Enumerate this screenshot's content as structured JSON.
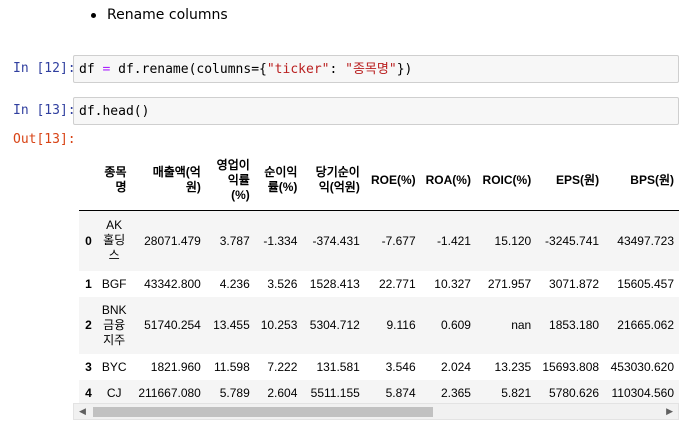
{
  "markdown": {
    "bullet": "Rename columns"
  },
  "cells": [
    {
      "prompt": "In [12]:",
      "code_parts": [
        "df ",
        "=",
        " df.rename(columns={",
        "\"ticker\"",
        ": ",
        "\"종목명\"",
        "})"
      ]
    },
    {
      "prompt": "In [13]:",
      "code": "df.head()"
    }
  ],
  "output_prompt": "Out[13]:",
  "table": {
    "columns": [
      "종목\n명",
      "매출액(억\n원)",
      "영업이\n익률\n(%)",
      "순이익\n률(%)",
      "당기순이\n익(억원)",
      "ROE(%)",
      "ROA(%)",
      "ROIC(%)",
      "EPS(원)",
      "BPS(원)"
    ],
    "rows": [
      {
        "index": "0",
        "cells": [
          "AK\n홀딩\n스",
          "28071.479",
          "3.787",
          "-1.334",
          "-374.431",
          "-7.677",
          "-1.421",
          "15.120",
          "-3245.741",
          "43497.723"
        ]
      },
      {
        "index": "1",
        "cells": [
          "BGF",
          "43342.800",
          "4.236",
          "3.526",
          "1528.413",
          "22.771",
          "10.327",
          "271.957",
          "3071.872",
          "15605.457"
        ]
      },
      {
        "index": "2",
        "cells": [
          "BNK\n금융\n지주",
          "51740.254",
          "13.455",
          "10.253",
          "5304.712",
          "9.116",
          "0.609",
          "nan",
          "1853.180",
          "21665.062"
        ]
      },
      {
        "index": "3",
        "cells": [
          "BYC",
          "1821.960",
          "11.598",
          "7.222",
          "131.581",
          "3.546",
          "2.024",
          "13.235",
          "15693.808",
          "453030.620"
        ]
      },
      {
        "index": "4",
        "cells": [
          "CJ",
          "211667.080",
          "5.789",
          "2.604",
          "5511.155",
          "5.874",
          "2.365",
          "5.821",
          "5780.626",
          "110304.560"
        ]
      }
    ]
  },
  "scrollbar": {
    "left_arrow": "◀",
    "right_arrow": "▶"
  }
}
